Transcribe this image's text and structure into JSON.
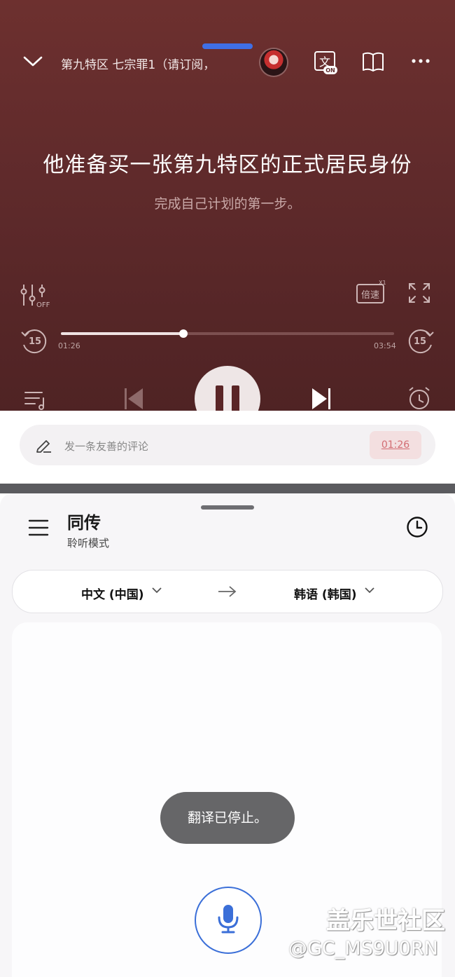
{
  "player": {
    "title": "第九特区 七宗罪1（请订阅，",
    "lyric_main": "他准备买一张第九特区的正式居民身份",
    "lyric_sub": "完成自己计划的第一步。",
    "eq_label": "OFF",
    "speed_label": "倍速",
    "speed_value": "X1",
    "translate_badge": "ON",
    "skip_back_seconds": "15",
    "skip_forward_seconds": "15",
    "elapsed": "01:26",
    "duration": "03:54",
    "progress_fraction": 0.367
  },
  "comment": {
    "placeholder": "发一条友善的评论",
    "timestamp": "01:26"
  },
  "translator": {
    "title": "同传",
    "subtitle": "聆听模式",
    "source_lang": "中文 (中国)",
    "target_lang": "韩语 (韩国)",
    "toast": "翻译已停止。"
  },
  "watermark": {
    "line1": "盖乐世社区",
    "line2": "@GC_MS9U0RN"
  },
  "colors": {
    "player_bg": "#5f2a2b",
    "accent_blue": "#3b6fd8",
    "comment_time": "#d26c72"
  }
}
